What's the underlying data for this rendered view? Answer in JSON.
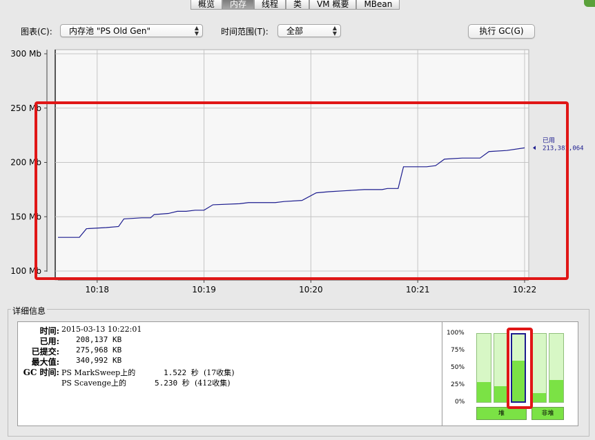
{
  "tabs": [
    "概览",
    "内存",
    "线程",
    "类",
    "VM 概要",
    "MBean"
  ],
  "toolbar": {
    "chart_label": "图表(C):",
    "chart_value": "内存池 \"PS Old Gen\"",
    "range_label": "时间范围(T):",
    "range_value": "全部",
    "gc_button": "执行 GC(G)"
  },
  "chart_data": {
    "type": "line",
    "y_ticks": [
      "300 Mb",
      "250 Mb",
      "200 Mb",
      "150 Mb",
      "100 Mb"
    ],
    "ylim": [
      100,
      300
    ],
    "x_ticks": [
      "10:18",
      "10:19",
      "10:20",
      "10:21",
      "10:22"
    ],
    "xlim": [
      "10:17:38",
      "10:22:00"
    ],
    "series": [
      {
        "name": "已用",
        "points": [
          [
            "10:17:38",
            131
          ],
          [
            "10:17:50",
            131
          ],
          [
            "10:17:54",
            139
          ],
          [
            "10:18:05",
            140
          ],
          [
            "10:18:12",
            141
          ],
          [
            "10:18:15",
            148
          ],
          [
            "10:18:25",
            149
          ],
          [
            "10:18:30",
            149
          ],
          [
            "10:18:32",
            152
          ],
          [
            "10:18:40",
            153
          ],
          [
            "10:18:45",
            155
          ],
          [
            "10:18:50",
            155
          ],
          [
            "10:18:55",
            156
          ],
          [
            "10:19:00",
            156
          ],
          [
            "10:19:05",
            161
          ],
          [
            "10:19:20",
            162
          ],
          [
            "10:19:25",
            163
          ],
          [
            "10:19:40",
            163
          ],
          [
            "10:19:45",
            164
          ],
          [
            "10:19:55",
            165
          ],
          [
            "10:20:03",
            172
          ],
          [
            "10:20:10",
            173
          ],
          [
            "10:20:20",
            174
          ],
          [
            "10:20:30",
            175
          ],
          [
            "10:20:40",
            175
          ],
          [
            "10:20:43",
            176
          ],
          [
            "10:20:49",
            176
          ],
          [
            "10:20:52",
            196
          ],
          [
            "10:21:05",
            196
          ],
          [
            "10:21:10",
            197
          ],
          [
            "10:21:15",
            203
          ],
          [
            "10:21:25",
            204
          ],
          [
            "10:21:35",
            204
          ],
          [
            "10:21:40",
            210
          ],
          [
            "10:21:50",
            211
          ],
          [
            "10:22:00",
            213.4
          ]
        ]
      }
    ],
    "current_label": "已用",
    "current_value": "213,381,064"
  },
  "details": {
    "title": "详细信息",
    "time_label": "时间:",
    "time_value": "2015-03-13 10:22:01",
    "used_label": "已用:",
    "used_value": "208,137 KB",
    "committed_label": "已提交:",
    "committed_value": "275,968 KB",
    "max_label": "最大值:",
    "max_value": "340,992 KB",
    "gc_label": "GC 时间:",
    "gc1_name": "PS MarkSweep上的",
    "gc1_time": "1.522 秒",
    "gc1_count": "(17收集)",
    "gc2_name": "PS Scavenge上的",
    "gc2_time": "5.230 秒",
    "gc2_count": "(412收集)"
  },
  "pools": {
    "ticks": [
      "100%",
      "75%",
      "50%",
      "25%",
      "0%"
    ],
    "fill": [
      0.29,
      0.23,
      0.61,
      0.13,
      0.32
    ],
    "heap_label": "堆",
    "nonheap_label": "非堆"
  }
}
